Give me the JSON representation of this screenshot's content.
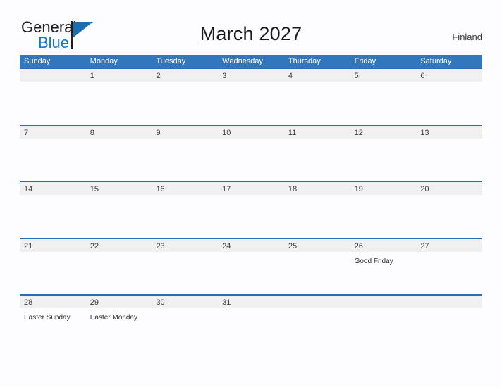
{
  "brand": {
    "name_part1": "General",
    "name_part2": "Blue",
    "flag_icon": "flag-icon"
  },
  "header": {
    "title": "March 2027",
    "region": "Finland"
  },
  "colors": {
    "header_blue": "#3277bc",
    "row_rule_blue": "#2a6db4",
    "day_band_gray": "#f0f0f0",
    "brand_blue": "#1479c4",
    "page_background": "#fdfdff"
  },
  "calendar": {
    "weekdays": [
      "Sunday",
      "Monday",
      "Tuesday",
      "Wednesday",
      "Thursday",
      "Friday",
      "Saturday"
    ],
    "weeks": [
      {
        "days": [
          {
            "num": "",
            "event": ""
          },
          {
            "num": "1",
            "event": ""
          },
          {
            "num": "2",
            "event": ""
          },
          {
            "num": "3",
            "event": ""
          },
          {
            "num": "4",
            "event": ""
          },
          {
            "num": "5",
            "event": ""
          },
          {
            "num": "6",
            "event": ""
          }
        ]
      },
      {
        "days": [
          {
            "num": "7",
            "event": ""
          },
          {
            "num": "8",
            "event": ""
          },
          {
            "num": "9",
            "event": ""
          },
          {
            "num": "10",
            "event": ""
          },
          {
            "num": "11",
            "event": ""
          },
          {
            "num": "12",
            "event": ""
          },
          {
            "num": "13",
            "event": ""
          }
        ]
      },
      {
        "days": [
          {
            "num": "14",
            "event": ""
          },
          {
            "num": "15",
            "event": ""
          },
          {
            "num": "16",
            "event": ""
          },
          {
            "num": "17",
            "event": ""
          },
          {
            "num": "18",
            "event": ""
          },
          {
            "num": "19",
            "event": ""
          },
          {
            "num": "20",
            "event": ""
          }
        ]
      },
      {
        "days": [
          {
            "num": "21",
            "event": ""
          },
          {
            "num": "22",
            "event": ""
          },
          {
            "num": "23",
            "event": ""
          },
          {
            "num": "24",
            "event": ""
          },
          {
            "num": "25",
            "event": ""
          },
          {
            "num": "26",
            "event": "Good Friday"
          },
          {
            "num": "27",
            "event": ""
          }
        ]
      },
      {
        "days": [
          {
            "num": "28",
            "event": "Easter Sunday"
          },
          {
            "num": "29",
            "event": "Easter Monday"
          },
          {
            "num": "30",
            "event": ""
          },
          {
            "num": "31",
            "event": ""
          },
          {
            "num": "",
            "event": ""
          },
          {
            "num": "",
            "event": ""
          },
          {
            "num": "",
            "event": ""
          }
        ]
      }
    ]
  }
}
